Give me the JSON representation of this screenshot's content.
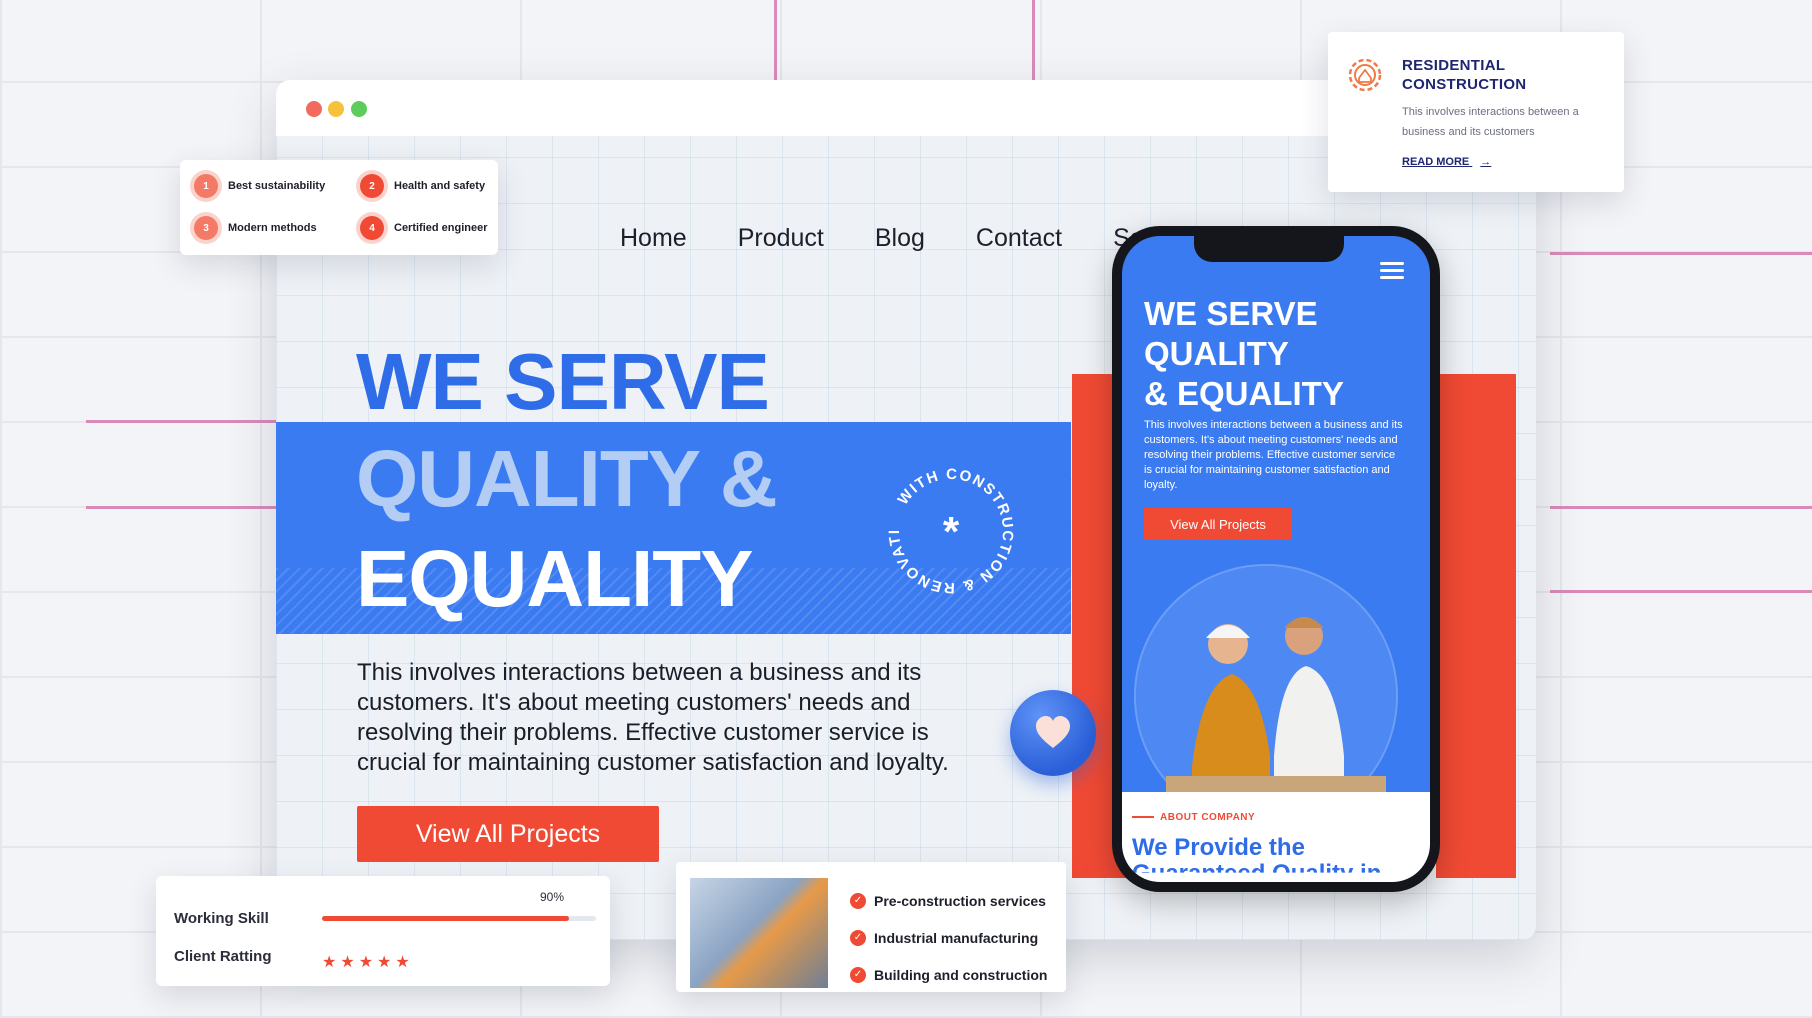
{
  "nav": {
    "items": [
      "Home",
      "Product",
      "Blog",
      "Contact",
      "Services"
    ]
  },
  "hero": {
    "line1": "WE SERVE",
    "line2": "QUALITY &",
    "line3": "EQUALITY",
    "description": "This involves interactions between a business and its customers. It's about meeting customers' needs and resolving their problems. Effective customer service is crucial for maintaining customer satisfaction and loyalty.",
    "cta_label": "View All Projects",
    "badge_text": "WITH CONSTRUCTION & RENOVATION"
  },
  "features": [
    {
      "num": "1",
      "label": "Best sustainability"
    },
    {
      "num": "2",
      "label": "Health and safety"
    },
    {
      "num": "3",
      "label": "Modern methods"
    },
    {
      "num": "4",
      "label": "Certified engineer"
    }
  ],
  "residential": {
    "title_line1": "RESIDENTIAL",
    "title_line2": "CONSTRUCTION",
    "description": "This involves interactions between a business and its customers",
    "read_more": "READ MORE"
  },
  "phone": {
    "title_line1": "WE SERVE",
    "title_line2": "QUALITY",
    "title_line3": "& EQUALITY",
    "description": "This involves interactions between a business and its customers. It's about meeting customers' needs and resolving their problems. Effective customer service is crucial for maintaining customer satisfaction and loyalty.",
    "cta_label": "View All Projects",
    "about_label": "ABOUT COMPANY",
    "heading_line1": "We Provide the",
    "heading_line2": "Guaranteed Quality in"
  },
  "skills": {
    "working_label": "Working Skill",
    "working_pct_label": "90%",
    "working_value": 0.9,
    "rating_label": "Client Ratting",
    "rating_stars": 5
  },
  "services": {
    "items": [
      "Pre-construction services",
      "Industrial manufacturing",
      "Building and construction"
    ]
  },
  "colors": {
    "accent_blue": "#3b7bf1",
    "accent_red": "#f14a34",
    "dark_navy": "#1f2570"
  }
}
